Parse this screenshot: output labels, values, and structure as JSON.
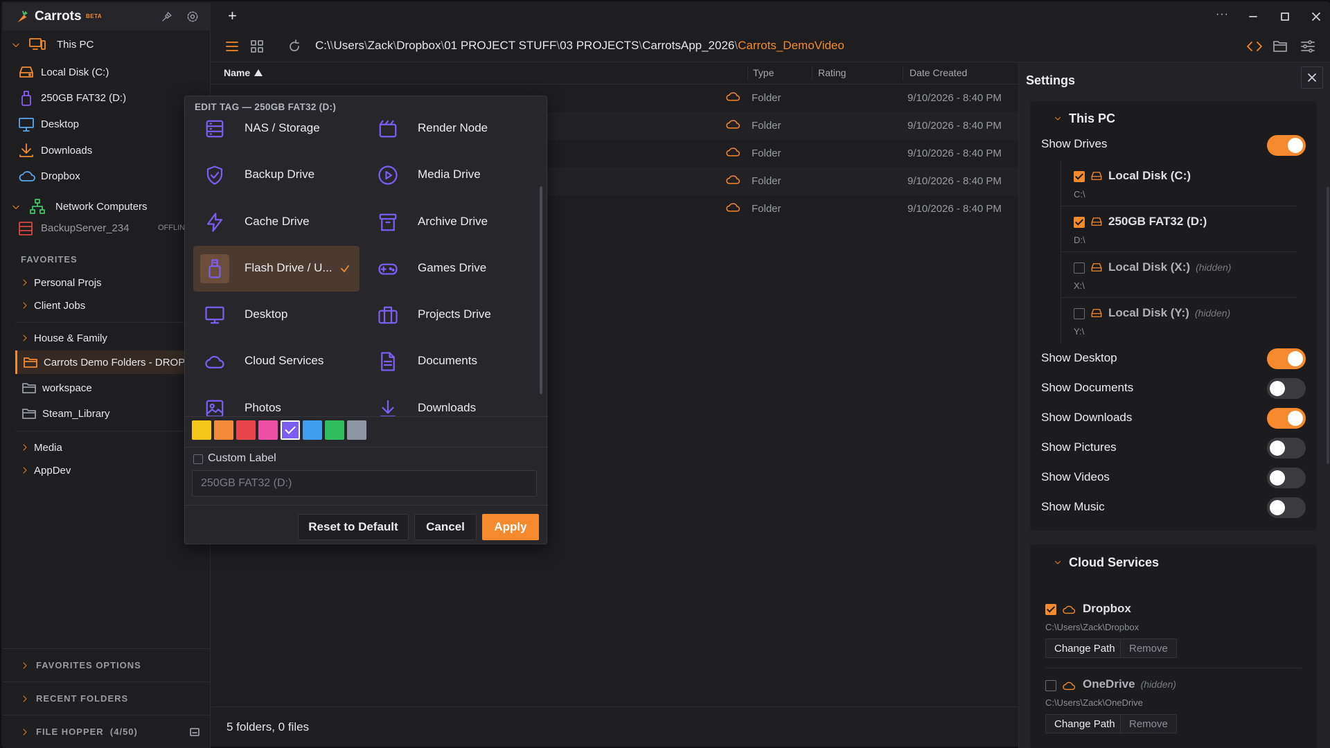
{
  "app": {
    "name": "Carrots",
    "badge": "BETA"
  },
  "sidebar": {
    "this_pc": "This PC",
    "drives": [
      {
        "label": "Local Disk (C:)"
      },
      {
        "label": "250GB FAT32 (D:)"
      }
    ],
    "locations": [
      "Desktop",
      "Downloads",
      "Dropbox"
    ],
    "network": {
      "label": "Network Computers",
      "server": "BackupServer_234",
      "server_status": "OFFLINE"
    },
    "favorites_label": "FAVORITES",
    "favorites": [
      "Personal Projs",
      "Client Jobs",
      "House & Family"
    ],
    "favorite_folders": [
      "Carrots Demo Folders - DROPBOX",
      "workspace",
      "Steam_Library"
    ],
    "groups": [
      "Media",
      "AppDev"
    ],
    "footer": {
      "favorites_options": "FAVORITES OPTIONS",
      "recent_folders": "RECENT FOLDERS",
      "file_hopper": "FILE HOPPER  (4/50)"
    }
  },
  "toolbar": {
    "add": "+",
    "more": "···"
  },
  "breadcrumb": [
    "C:\\",
    "Users",
    "Zack",
    "Dropbox",
    "01 PROJECT STUFF",
    "03 PROJECTS",
    "CarrotsApp_2026",
    "Carrots_DemoVideo"
  ],
  "list": {
    "columns": {
      "name": "Name",
      "type": "Type",
      "rating": "Rating",
      "date": "Date Created"
    },
    "rows": [
      {
        "type": "Folder",
        "date": "9/10/2026 - 8:40 PM"
      },
      {
        "type": "Folder",
        "date": "9/10/2026 - 8:40 PM"
      },
      {
        "type": "Folder",
        "date": "9/10/2026 - 8:40 PM"
      },
      {
        "type": "Folder",
        "date": "9/10/2026 - 8:40 PM"
      },
      {
        "type": "Folder",
        "date": "9/10/2026 - 8:40 PM"
      }
    ],
    "status": "5 folders, 0 files"
  },
  "popover": {
    "title": "EDIT TAG — 250GB FAT32 (D:)",
    "tags": [
      {
        "label": "NAS / Storage",
        "icon": "server-icon"
      },
      {
        "label": "Render Node",
        "icon": "clapper-icon"
      },
      {
        "label": "Backup Drive",
        "icon": "shield-icon"
      },
      {
        "label": "Media Drive",
        "icon": "play-icon"
      },
      {
        "label": "Cache Drive",
        "icon": "bolt-icon"
      },
      {
        "label": "Archive Drive",
        "icon": "archive-icon"
      },
      {
        "label": "Flash Drive / U...",
        "icon": "usb-icon",
        "selected": true
      },
      {
        "label": "Games Drive",
        "icon": "gamepad-icon"
      },
      {
        "label": "Desktop",
        "icon": "monitor-icon"
      },
      {
        "label": "Projects Drive",
        "icon": "briefcase-icon"
      },
      {
        "label": "Cloud Services",
        "icon": "cloud-icon"
      },
      {
        "label": "Documents",
        "icon": "document-icon"
      },
      {
        "label": "Photos",
        "icon": "photo-icon"
      },
      {
        "label": "Downloads",
        "icon": "download-icon"
      }
    ],
    "colors": [
      "#f5c518",
      "#f28c38",
      "#e9454d",
      "#ec4fa3",
      "#7c5ef2",
      "#3f9ef0",
      "#2fbe5b",
      "#8f96a3"
    ],
    "selected_color": "#7c5ef2",
    "custom_label": "Custom Label",
    "custom_placeholder": "250GB FAT32 (D:)",
    "buttons": {
      "reset": "Reset to Default",
      "cancel": "Cancel",
      "apply": "Apply"
    }
  },
  "settings": {
    "title": "Settings",
    "this_pc": {
      "heading": "This PC",
      "show_drives": "Show Drives",
      "show_drives_on": true,
      "drives": [
        {
          "name": "Local Disk (C:)",
          "path": "C:\\",
          "checked": true,
          "hidden": ""
        },
        {
          "name": "250GB FAT32 (D:)",
          "path": "D:\\",
          "checked": true,
          "hidden": ""
        },
        {
          "name": "Local Disk (X:)",
          "path": "X:\\",
          "checked": false,
          "hidden": "(hidden)"
        },
        {
          "name": "Local Disk (Y:)",
          "path": "Y:\\",
          "checked": false,
          "hidden": "(hidden)"
        }
      ],
      "toggles": [
        {
          "label": "Show Desktop",
          "on": true
        },
        {
          "label": "Show Documents",
          "on": false
        },
        {
          "label": "Show Downloads",
          "on": true
        },
        {
          "label": "Show Pictures",
          "on": false
        },
        {
          "label": "Show Videos",
          "on": false
        },
        {
          "label": "Show Music",
          "on": false
        }
      ]
    },
    "cloud": {
      "heading": "Cloud Services",
      "services": [
        {
          "name": "Dropbox",
          "path": "C:\\Users\\Zack\\Dropbox",
          "checked": true,
          "hidden": ""
        },
        {
          "name": "OneDrive",
          "path": "C:\\Users\\Zack\\OneDrive",
          "checked": false,
          "hidden": "(hidden)"
        }
      ],
      "change_path": "Change Path",
      "remove": "Remove"
    }
  },
  "colors": {
    "accent": "#f48a2d",
    "tag_purple": "#7c5ef2",
    "bg": "#1e1e21",
    "panel": "#232327"
  }
}
